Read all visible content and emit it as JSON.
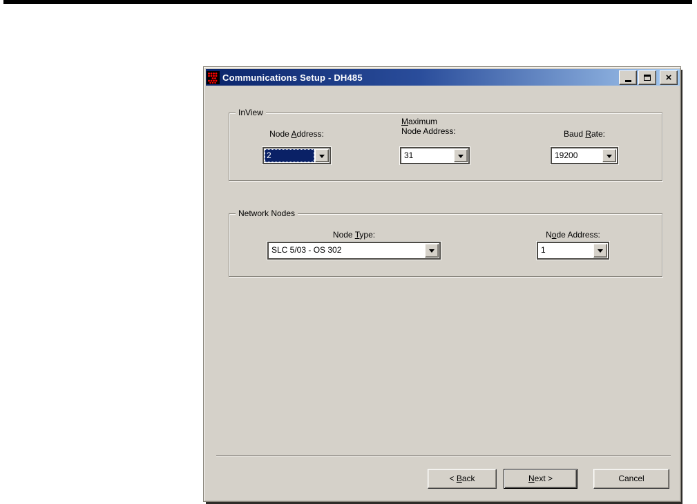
{
  "window": {
    "title": "Communications Setup - DH485",
    "close_glyph": "×",
    "colors": {
      "titlebar_left": "#0a246a",
      "titlebar_right": "#a6caf0",
      "dialog_face": "#d5d1c9",
      "selection_bg": "#0a2166",
      "selection_text": "#ffffff",
      "icon_dots": "#ff0000"
    }
  },
  "inview": {
    "label": "InView",
    "node_address": {
      "label": {
        "pre": "Node ",
        "key": "A",
        "post": "ddress:"
      },
      "value": "2"
    },
    "max_node_address": {
      "label_line1": {
        "pre": "",
        "key": "M",
        "post": "aximum"
      },
      "label_line2": {
        "pre": "Node Address:",
        "key": "",
        "post": ""
      },
      "value": "31"
    },
    "baud_rate": {
      "label": {
        "pre": "Baud ",
        "key": "R",
        "post": "ate:"
      },
      "value": "19200"
    }
  },
  "network": {
    "label": "Network Nodes",
    "node_type": {
      "label": {
        "pre": "Node ",
        "key": "T",
        "post": "ype:"
      },
      "value": "SLC 5/03 - OS 302"
    },
    "node_address": {
      "label": {
        "pre": "N",
        "key": "o",
        "post": "de Address:"
      },
      "value": "1"
    }
  },
  "buttons": {
    "back": {
      "pre": "< ",
      "key": "B",
      "post": "ack"
    },
    "next": {
      "pre": "",
      "key": "N",
      "post": "ext >"
    },
    "cancel": {
      "pre": "",
      "key": "",
      "post": "Cancel"
    }
  }
}
